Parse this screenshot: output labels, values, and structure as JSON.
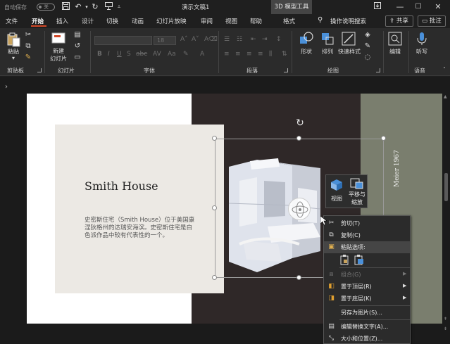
{
  "titlebar": {
    "autosave": "自动保存",
    "toggle_state": "关",
    "doc_title": "演示文稿1",
    "context_tool": "3D 模型工具"
  },
  "tabs": [
    "文件",
    "开始",
    "插入",
    "设计",
    "切换",
    "动画",
    "幻灯片放映",
    "审阅",
    "视图",
    "帮助",
    "格式"
  ],
  "active_tab": "开始",
  "search": {
    "label": "操作说明搜索"
  },
  "share_label": "共享",
  "comment_label": "批注",
  "ribbon": {
    "clipboard": {
      "paste": "粘贴",
      "group": "剪贴板"
    },
    "slides": {
      "new_slide_1": "新建",
      "new_slide_2": "幻灯片",
      "group": "幻灯片"
    },
    "font": {
      "group": "字体",
      "size": "18"
    },
    "paragraph": {
      "group": "段落"
    },
    "drawing": {
      "shape": "形状",
      "arrange": "排列",
      "quick_style": "快速样式",
      "group": "绘图"
    },
    "editing": {
      "label": "编辑"
    },
    "voice": {
      "dictate": "听写",
      "group": "语音"
    }
  },
  "slide": {
    "title": "Smith House",
    "body": "史密斯住宅（Smith House）位于美国康涅狄格州的达瑞安海滨。史密斯住宅是白色派作品中较有代表性的一个。",
    "vertical_text": "Meier 1967"
  },
  "mini_toolbar": {
    "view": "视图",
    "pan_zoom_1": "平移与",
    "pan_zoom_2": "缩放"
  },
  "context_menu": {
    "items": [
      {
        "label": "剪切(T)",
        "icon": "scissors-icon"
      },
      {
        "label": "复制(C)",
        "icon": "copy-icon"
      },
      {
        "label": "粘贴选项:",
        "icon": "paste-icon"
      },
      {
        "label": "组合(G)",
        "icon": "group-icon"
      },
      {
        "label": "置于顶层(R)",
        "icon": "bring-front-icon"
      },
      {
        "label": "置于底层(K)",
        "icon": "send-back-icon"
      },
      {
        "label": "另存为图片(S)...",
        "icon": ""
      },
      {
        "label": "编辑替换文字(A)...",
        "icon": "alt-text-icon"
      },
      {
        "label": "大小和位置(Z)...",
        "icon": "size-position-icon"
      }
    ]
  },
  "colors": {
    "accent": "#d24726",
    "slide_dark": "#2f2828",
    "slide_olive": "#7a7e6e",
    "card_bg": "#ece9e4"
  }
}
